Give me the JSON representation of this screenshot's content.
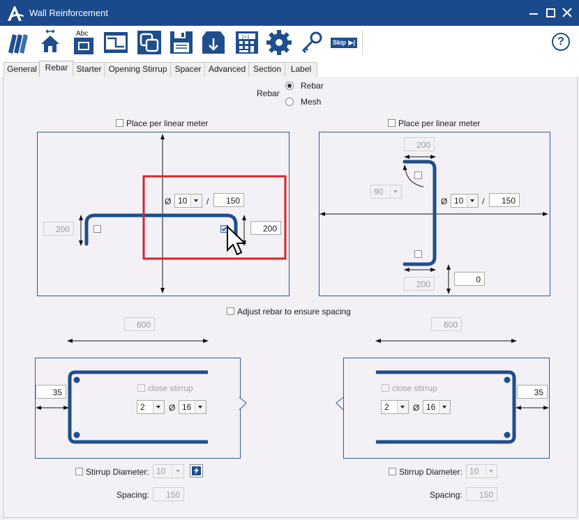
{
  "window": {
    "title": "Wall Reinforcement"
  },
  "toolbar": {
    "skip_label": "Skip",
    "help_label": "?",
    "abc_label": "Abc",
    "plusone_label": "1+1"
  },
  "tabs": [
    "General",
    "Rebar",
    "Starter",
    "Opening Stirrup",
    "Spacer",
    "Advanced",
    "Section",
    "Label"
  ],
  "rebar_type": {
    "label": "Rebar",
    "options": [
      "Rebar",
      "Mesh"
    ],
    "selected": "Rebar"
  },
  "left_panel": {
    "place_per_meter": "Place per linear meter",
    "diameter_symbol": "Ø",
    "diameter": "10",
    "slash": "/",
    "spacing": "150",
    "left_length": "200",
    "right_length": "200"
  },
  "right_panel": {
    "place_per_meter": "Place per linear meter",
    "top_length": "200",
    "angle": "90",
    "diameter_symbol": "Ø",
    "diameter": "10",
    "slash": "/",
    "spacing": "150",
    "bottom_length": "200",
    "offset": "0"
  },
  "adjust_spacing": "Adjust rebar to ensure spacing",
  "left_stirrup": {
    "width": "600",
    "cover": "35",
    "close_stirrup": "close stirrup",
    "count": "2",
    "diameter_symbol": "Ø",
    "diameter": "16",
    "stirrup_diameter_label": "Stirrup Diameter:",
    "stirrup_diameter": "10",
    "spacing_label": "Spacing:",
    "spacing": "150"
  },
  "right_stirrup": {
    "width": "600",
    "cover": "35",
    "close_stirrup": "close stirrup",
    "count": "2",
    "diameter_symbol": "Ø",
    "diameter": "16",
    "stirrup_diameter_label": "Stirrup Diameter:",
    "stirrup_diameter": "10",
    "spacing_label": "Spacing:",
    "spacing": "150"
  },
  "colors": {
    "titlebar": "#1b4a8c",
    "rebar": "#1f4e8c",
    "highlight": "#d9232a"
  }
}
